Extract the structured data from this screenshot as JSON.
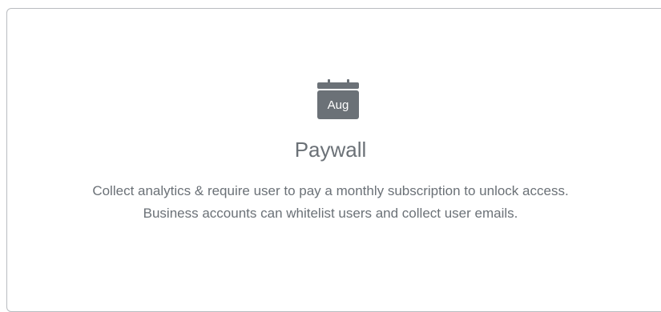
{
  "card": {
    "icon": {
      "name": "calendar-icon",
      "label": "Aug",
      "color": "#6b7177"
    },
    "title": "Paywall",
    "description_lines": [
      "Collect analytics & require user to pay a monthly subscription to unlock access.",
      "Business accounts can whitelist users and collect user emails."
    ]
  }
}
